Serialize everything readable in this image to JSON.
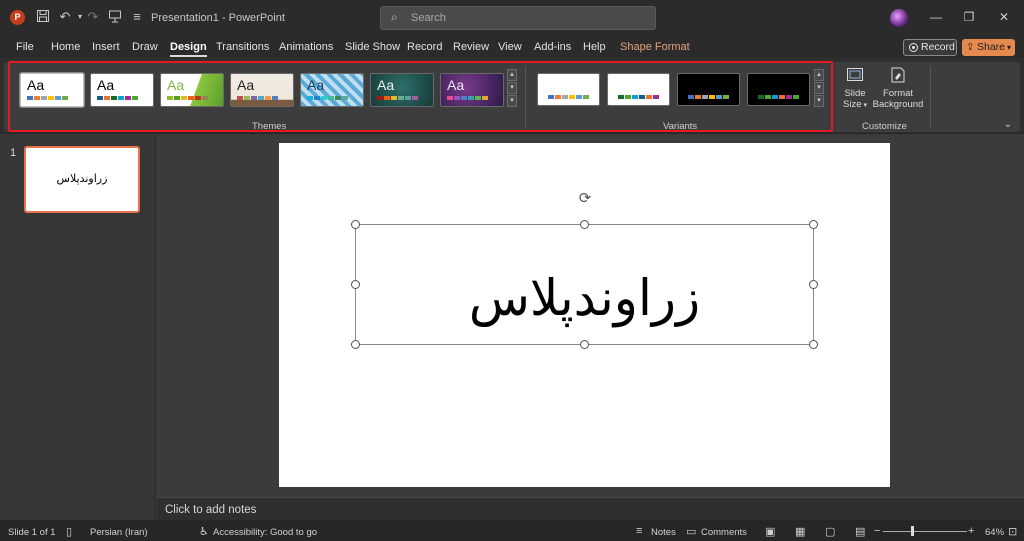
{
  "window": {
    "app_title": "Presentation1  -  PowerPoint",
    "search_placeholder": "Search"
  },
  "menu": {
    "tabs": [
      "File",
      "Home",
      "Insert",
      "Draw",
      "Design",
      "Transitions",
      "Animations",
      "Slide Show",
      "Record",
      "Review",
      "View",
      "Add-ins",
      "Help",
      "Shape Format"
    ],
    "active_tab": "Design",
    "record_label": "Record",
    "share_label": "Share"
  },
  "ribbon": {
    "themes_label": "Themes",
    "variants_label": "Variants",
    "customize_label": "Customize",
    "theme_sample_text": "Aa",
    "slide_size_label_1": "Slide",
    "slide_size_label_2": "Size",
    "format_bg_label_1": "Format",
    "format_bg_label_2": "Background"
  },
  "slides": {
    "thumb_number": "1",
    "thumb_text": "زراوندپلاس",
    "title_text": "زراوندپلاس",
    "notes_placeholder": "Click to add notes"
  },
  "status": {
    "slide_counter": "Slide 1 of 1",
    "language": "Persian (Iran)",
    "accessibility": "Accessibility: Good to go",
    "notes_label": "Notes",
    "comments_label": "Comments",
    "zoom": "64%"
  },
  "colors": {
    "highlight_border": "#e01b24",
    "share_button": "#e48a4f",
    "selected_thumbnail_border": "#e8734b"
  }
}
